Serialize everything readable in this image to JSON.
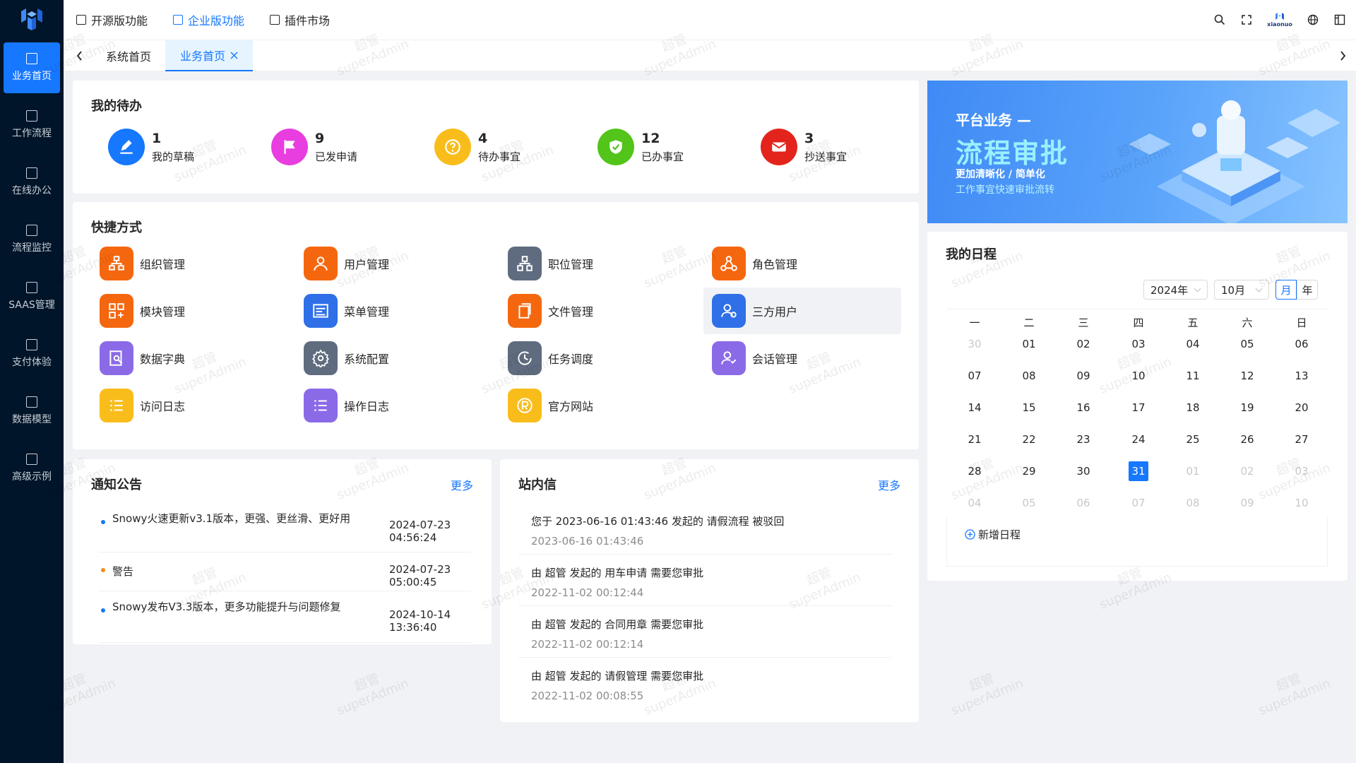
{
  "sidebar": {
    "items": [
      {
        "label": "业务首页",
        "icon": "home-icon",
        "active": true
      },
      {
        "label": "工作流程",
        "icon": "workflow-icon"
      },
      {
        "label": "在线办公",
        "icon": "monitor-icon"
      },
      {
        "label": "流程监控",
        "icon": "monitor-chart-icon"
      },
      {
        "label": "SAAS管理",
        "icon": "grid-icon"
      },
      {
        "label": "支付体验",
        "icon": "grid-icon"
      },
      {
        "label": "数据模型",
        "icon": "table-icon"
      },
      {
        "label": "高级示例",
        "icon": "code-icon"
      }
    ]
  },
  "topnav": {
    "items": [
      {
        "label": "开源版功能",
        "icon": "grid-icon"
      },
      {
        "label": "企业版功能",
        "icon": "document-icon",
        "active": true
      },
      {
        "label": "插件市场",
        "icon": "plugin-icon"
      }
    ]
  },
  "topright": {
    "brand": "xiaonuo"
  },
  "tabs": [
    {
      "label": "系统首页"
    },
    {
      "label": "业务首页",
      "active": true
    }
  ],
  "todo": {
    "title": "我的待办",
    "items": [
      {
        "count": "1",
        "label": "我的草稿",
        "color": "#1677ff",
        "icon": "edit-icon"
      },
      {
        "count": "9",
        "label": "已发申请",
        "color": "#e83ee0",
        "icon": "flag-icon"
      },
      {
        "count": "4",
        "label": "待办事宜",
        "color": "#f9bd1b",
        "icon": "question-icon"
      },
      {
        "count": "12",
        "label": "已办事宜",
        "color": "#52c41a",
        "icon": "shield-check-icon"
      },
      {
        "count": "3",
        "label": "抄送事宜",
        "color": "#e3241c",
        "icon": "mail-icon"
      }
    ]
  },
  "shortcuts": {
    "title": "快捷方式",
    "items": [
      {
        "label": "组织管理",
        "color": "#f5670f",
        "icon": "org-icon"
      },
      {
        "label": "用户管理",
        "color": "#f5670f",
        "icon": "user-icon"
      },
      {
        "label": "职位管理",
        "color": "#5f6c7f",
        "icon": "hierarchy-icon"
      },
      {
        "label": "角色管理",
        "color": "#f5670f",
        "icon": "role-icon"
      },
      {
        "label": "模块管理",
        "color": "#f5670f",
        "icon": "module-icon"
      },
      {
        "label": "菜单管理",
        "color": "#2f6fe8",
        "icon": "menu-icon"
      },
      {
        "label": "文件管理",
        "color": "#f5670f",
        "icon": "file-icon"
      },
      {
        "label": "三方用户",
        "color": "#2f6fe8",
        "icon": "third-user-icon"
      },
      {
        "label": "数据字典",
        "color": "#8b6ae8",
        "icon": "dictionary-icon"
      },
      {
        "label": "系统配置",
        "color": "#5f6c7f",
        "icon": "gear-icon"
      },
      {
        "label": "任务调度",
        "color": "#5f6c7f",
        "icon": "clock-icon"
      },
      {
        "label": "会话管理",
        "color": "#8b6ae8",
        "icon": "session-icon"
      },
      {
        "label": "访问日志",
        "color": "#f9bd1b",
        "icon": "list-icon"
      },
      {
        "label": "操作日志",
        "color": "#8b6ae8",
        "icon": "list-icon"
      },
      {
        "label": "官方网站",
        "color": "#f9bd1b",
        "icon": "registered-icon"
      }
    ]
  },
  "notice": {
    "title": "通知公告",
    "more": "更多",
    "items": [
      {
        "title": "Snowy火速更新v3.1版本，更强、更丝滑、更好用",
        "date": "2024-07-23 04:56:24",
        "color": "#1677ff"
      },
      {
        "title": "警告",
        "date": "2024-07-23 05:00:45",
        "color": "#fa8c16"
      },
      {
        "title": "Snowy发布V3.3版本，更多功能提升与问题修复",
        "date": "2024-10-14 13:36:40",
        "color": "#1677ff"
      }
    ]
  },
  "messages": {
    "title": "站内信",
    "more": "更多",
    "items": [
      {
        "title": "您于 2023-06-16 01:43:46 发起的 请假流程 被驳回",
        "date": "2023-06-16 01:43:46"
      },
      {
        "title": "由 超管 发起的 用车申请 需要您审批",
        "date": "2022-11-02 00:12:44"
      },
      {
        "title": "由 超管 发起的 合同用章 需要您审批",
        "date": "2022-11-02 00:12:14"
      },
      {
        "title": "由 超管 发起的 请假管理 需要您审批",
        "date": "2022-11-02 00:08:55"
      }
    ]
  },
  "banner": {
    "line1": "平台业务 —",
    "line2": "流程审批",
    "line3": "更加清晰化 / 简单化",
    "line4": "工作事宜快速审批流转"
  },
  "calendar": {
    "title": "我的日程",
    "year": "2024年",
    "month": "10月",
    "mode_month": "月",
    "mode_year": "年",
    "weekdays": [
      "一",
      "二",
      "三",
      "四",
      "五",
      "六",
      "日"
    ],
    "today": "31",
    "weeks": [
      [
        "30",
        "01",
        "02",
        "03",
        "04",
        "05",
        "06"
      ],
      [
        "07",
        "08",
        "09",
        "10",
        "11",
        "12",
        "13"
      ],
      [
        "14",
        "15",
        "16",
        "17",
        "18",
        "19",
        "20"
      ],
      [
        "21",
        "22",
        "23",
        "24",
        "25",
        "26",
        "27"
      ],
      [
        "28",
        "29",
        "30",
        "31",
        "01",
        "02",
        "03"
      ],
      [
        "04",
        "05",
        "06",
        "07",
        "08",
        "09",
        "10"
      ]
    ],
    "add_label": "新增日程"
  },
  "watermark": {
    "line1": "超管",
    "line2": "superAdmin"
  },
  "colors": {
    "primary": "#1677ff",
    "sidebar_bg": "#001529"
  }
}
